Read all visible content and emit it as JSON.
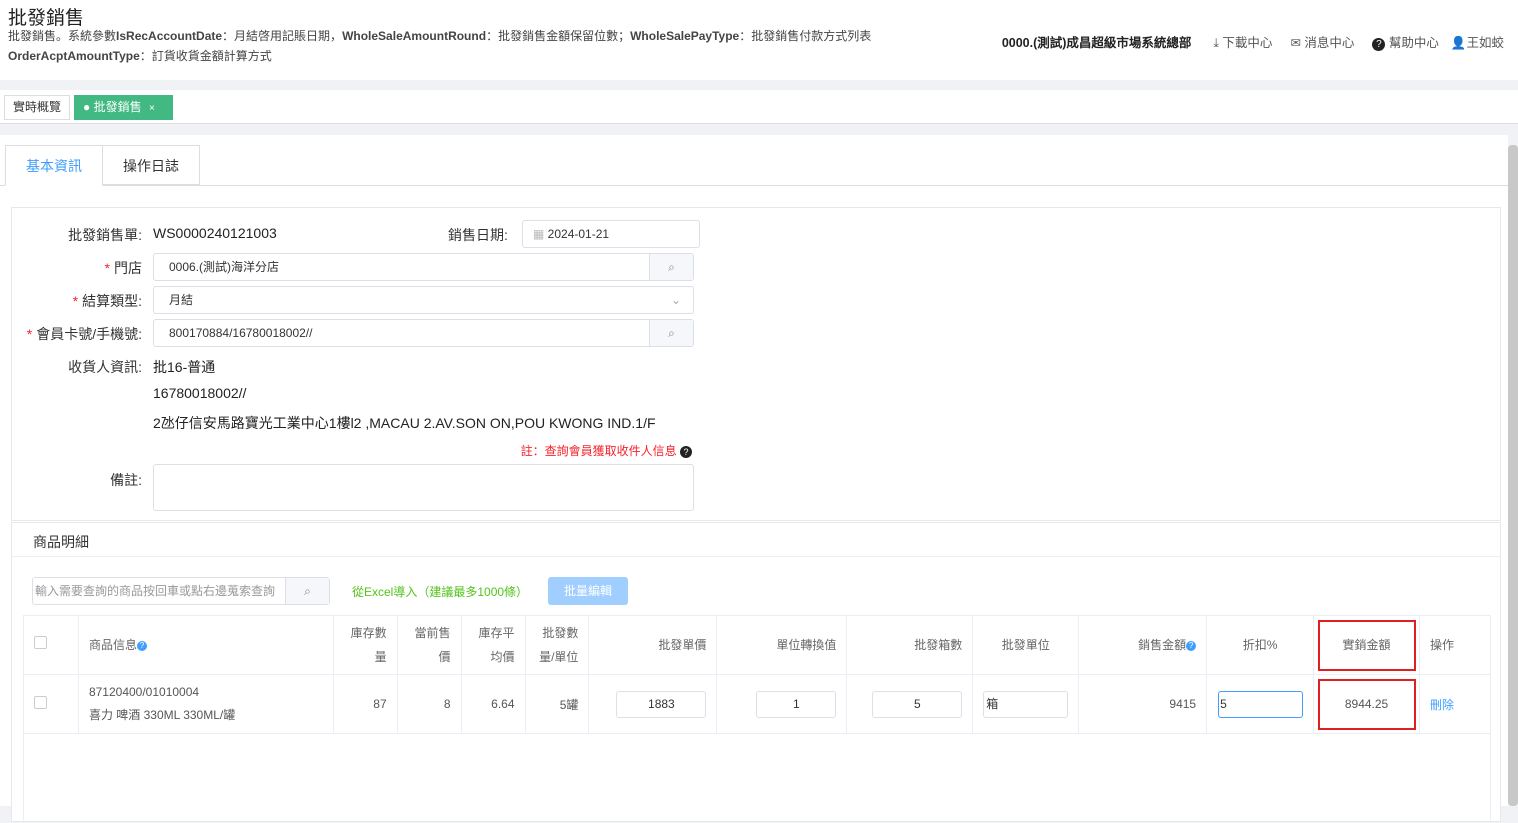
{
  "header": {
    "title": "批發銷售",
    "desc_line1_parts": [
      "批發銷售。系統參數",
      "IsRecAccountDate",
      "：月結啓用記賬日期，",
      "WholeSaleAmountRound",
      "：批發銷售金額保留位數；",
      "WholeSalePayType",
      "：批發銷售付款方式列表"
    ],
    "desc_line2_parts": [
      "OrderAcptAmountType",
      "：訂貨收貨金額計算方式"
    ],
    "org": "0000.(測試)成昌超級市場系統總部",
    "download": "下載中心",
    "messages": "消息中心",
    "help": "幫助中心",
    "user": "王如蛟"
  },
  "page_tabs": [
    {
      "label": "實時概覽"
    },
    {
      "label": "批發銷售",
      "close": "×"
    }
  ],
  "inner_tabs": [
    "基本資訊",
    "操作日誌"
  ],
  "form": {
    "order_label": "批發銷售單:",
    "order_no": "WS0000240121003",
    "date_label": "銷售日期:",
    "date": "2024-01-21",
    "store_label": "門店",
    "store": "0006.(測試)海洋分店",
    "settle_label": "結算類型:",
    "settle": "月結",
    "member_label": "會員卡號/手機號:",
    "member": "800170884/16780018002//",
    "receiver_label": "收貨人資訊:",
    "receiver_name": "批16-普通",
    "receiver_phone": "16780018002//",
    "receiver_addr": "2氹仔信安馬路寶光工業中心1樓l2 ,MACAU 2.AV.SON ON,POU KWONG IND.1/F",
    "note_hint": "註：查詢會員獲取收件人信息",
    "remark_label": "備註:",
    "remark": "",
    "required_mark": "*"
  },
  "products": {
    "title": "商品明細",
    "search_placeholder": "輸入需要查詢的商品按回車或點右邊蒐索查詢",
    "excel_import": "從Excel導入（建議最多1000條）",
    "batch_edit": "批量編輯",
    "columns": [
      "商品信息",
      "庫存數量",
      "當前售價",
      "庫存平均價",
      "批發數量/單位",
      "批發單價",
      "單位轉換值",
      "批發箱數",
      "批發單位",
      "銷售金額",
      "折扣%",
      "實銷金額",
      "操作"
    ],
    "rows": [
      {
        "code": "87120400/01010004",
        "name": "喜力 啤酒 330ML 330ML/罐",
        "stock": "87",
        "price": "8",
        "avg": "6.64",
        "qty": "5罐",
        "unit_price": "1883",
        "conv": "1",
        "boxes": "5",
        "unit": "箱",
        "amount": "9415",
        "discount": "5",
        "net": "8944.25",
        "action": "刪除"
      }
    ]
  },
  "colors": {
    "accent": "#409eff",
    "tab_active": "#42b983",
    "highlight": "#e02020"
  }
}
